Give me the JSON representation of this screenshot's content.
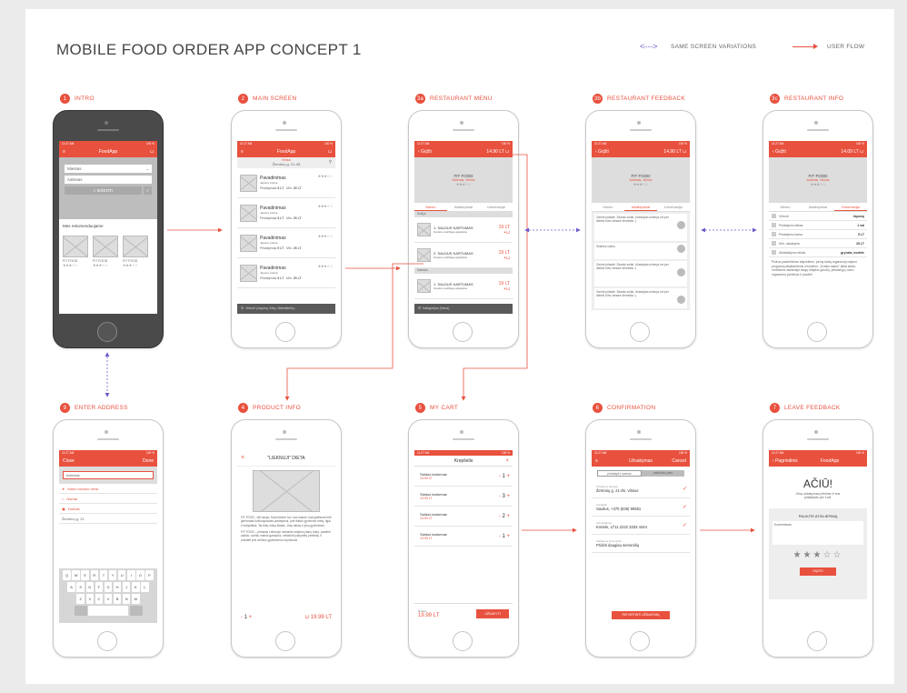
{
  "title": "MOBILE FOOD ORDER APP CONCEPT 1",
  "legend": {
    "variations": "SAME SCREEN VARIATIONS",
    "flow": "USER FLOW"
  },
  "accent": "#e8513e",
  "steps": [
    {
      "num": "1",
      "label": "INTRO"
    },
    {
      "num": "2",
      "label": "MAIN SCREEN"
    },
    {
      "num": "3a",
      "label": "RESTAURANT MENU"
    },
    {
      "num": "3b",
      "label": "RESTAURANT FEEDBACK"
    },
    {
      "num": "3c",
      "label": "RESTAURANT INFO"
    },
    {
      "num": "9",
      "label": "ENTER ADDRESS"
    },
    {
      "num": "4",
      "label": "PRODUCT INFO"
    },
    {
      "num": "5",
      "label": "MY CART"
    },
    {
      "num": "6",
      "label": "CONFIRMATION"
    },
    {
      "num": "7",
      "label": "LEAVE FEEDBACK"
    }
  ],
  "status": {
    "time": "11:27 AM",
    "battery": "100 %"
  },
  "intro": {
    "app": "FoodApp",
    "city": "Miestas",
    "address": "Adresas",
    "search": "IEŠKOTI",
    "rec": "Mes rekomenduojame",
    "items": [
      "FIT FOOD",
      "FIT FOOD",
      "FIT FOOD"
    ]
  },
  "main": {
    "app": "FoodApp",
    "loc_label": "Vilnius",
    "loc": "Žirmūnų g. 21-45",
    "item_name": "Pavadinimas",
    "item_sub": "Japonų virtuvė",
    "deliv": "Pristatymas",
    "deliv_val": "5 LT",
    "min": "Min.",
    "min_val": "25 LT",
    "filter": "Virtuvė (Japonų, Kinų, Meksikiečių..."
  },
  "menu": {
    "back": "Grįžti",
    "total": "14.90 LT",
    "rest": "FIT FOOD",
    "rest_sub": "Adresas, Vilnius",
    "tabs": [
      "Meniu",
      "Atsiliepimai",
      "Informacija"
    ],
    "sec1": "Sultys",
    "sec2": "Salotos",
    "dish": [
      "1. SALDUS KARTUMAS",
      "2. SALDUS KARTUMAS",
      "1. SALDUS KARTUMAS"
    ],
    "dish_desc": "Greitos medžiagų apykaitos",
    "price": "19 LT",
    "cat": "Kategorijos (Visos)"
  },
  "feedback": {
    "back": "Grįžti",
    "total": "14.90 LT",
    "rest": "FIT FOOD",
    "rest_sub": "Adresas, Vilnius",
    "texts": [
      "Gerinti pristatė. Skaniis sultai. Užsakytas mininys nei per didelis būvo viesam žemesliu :)",
      "Skanios sultos.",
      "Gerinti pristatė. Skaniis sultai. Užsakytas mininys nei per didelis būvo viesam žemesliu :)",
      "Gerinti pristatė. Skaniis sultai. Užsakytas mininys nei per didelis būvo viesam žemesliu :)"
    ]
  },
  "info": {
    "back": "Grįžti",
    "total": "14.09 LT",
    "rest": "FIT FOOD",
    "rest_sub": "Adresas, Vilnius",
    "rows": [
      [
        "Virtuvė",
        "Japonų"
      ],
      [
        "Pristatymo laikas",
        "1 val"
      ],
      [
        "Pristatymo kaina",
        "5 LT"
      ],
      [
        "Min. užsakymo",
        "25 LT"
      ],
      [
        "Atsiskaitymo būdai",
        "grynais, kortele"
      ]
    ],
    "desc": "Puikus pasirinkimas atlyvelėms, pirmą kartą organizuoj valymo programą atlaikantiems žmonėms. „Sveiko starto\" dieta skirta norintiems atsikratyti blogų mitybos įpročių, pirkiasiųjų į savo organizmo poreikius ir pradėti"
  },
  "address": {
    "close": "Close",
    "done": "Done",
    "placeholder": "Adresas",
    "opt1": "Mano buvimo vieta",
    "opt2": "Namai",
    "opt3": "Darbas",
    "street": "Žirmūnų g. 21",
    "keys": [
      [
        "Q",
        "W",
        "E",
        "R",
        "T",
        "Y",
        "U",
        "I",
        "O",
        "P"
      ],
      [
        "A",
        "S",
        "D",
        "F",
        "G",
        "H",
        "J",
        "K",
        "L"
      ],
      [
        "Z",
        "X",
        "C",
        "V",
        "B",
        "N",
        "M"
      ]
    ]
  },
  "product": {
    "title": "\"LIEKNUJI\" DIETA",
    "p1": "FIT FOOD - dėl savęs: Kad būtume tuo, kuo esame, kad galėtume būti geresniais kokliuojančiais pristatymui, prie dietos gyvenimo metų, ilgai ir kokybiškai. Tai būtų mūsų tikslas. Jūsų laikas ir jūsų gyvenimas.",
    "p2": "FIT FOOD – pirmasis Lietuvoje mokantis mitybos planų būdų, pasiekti aukšto, sveiko maisto gamybos, neišskirti pažymėtų perteklių ir prisidėti prie sveikos gyvensenos rūpinimosi.",
    "qty": "1",
    "price": "19.99 LT"
  },
  "cart": {
    "title": "Krepšelis",
    "items": [
      {
        "name": "Saldus kartumas",
        "price": "19.99 LT",
        "qty": "1"
      },
      {
        "name": "Saldus kartumas",
        "price": "19.99 LT",
        "qty": "3"
      },
      {
        "name": "Saldus kartumas",
        "price": "19.99 LT",
        "qty": "2"
      },
      {
        "name": "Saldus kartumas",
        "price": "19.99 LT",
        "qty": "1"
      }
    ],
    "total_label": "Iš viso:",
    "total": "19.99 LT",
    "order": "UŽSAKYTI"
  },
  "confirm": {
    "title": "Užsakymas",
    "cancel": "Cancel",
    "tabs": [
      "pristatyti į namus",
      "atsiimsiu pats"
    ],
    "fields": [
      [
        "Pristatymo adresas",
        "Žirmūnų g. 21-45, Vilnius"
      ],
      [
        "Kontaktai",
        "Saulius, +370 (636) 90851"
      ],
      [
        "Apmokėjimas",
        "Kortele, LT11 2222 3333 4444"
      ],
      [
        "Papildoma informacija",
        "Pridėti daugiau serverėlių"
      ]
    ],
    "btn": "PATVIRTINTI UŽSAKYMĄ"
  },
  "leave": {
    "back": "Pagrindinis",
    "app": "FoodApp",
    "thanks": "AČIŪ!",
    "msg": "Jūsų užsakymas priimtas ir bus pristatytas per 1val.",
    "head": "PALIKITE ATSILIEPIMĄ",
    "comment": "Komentaras",
    "btn": "SIŲSTI"
  }
}
